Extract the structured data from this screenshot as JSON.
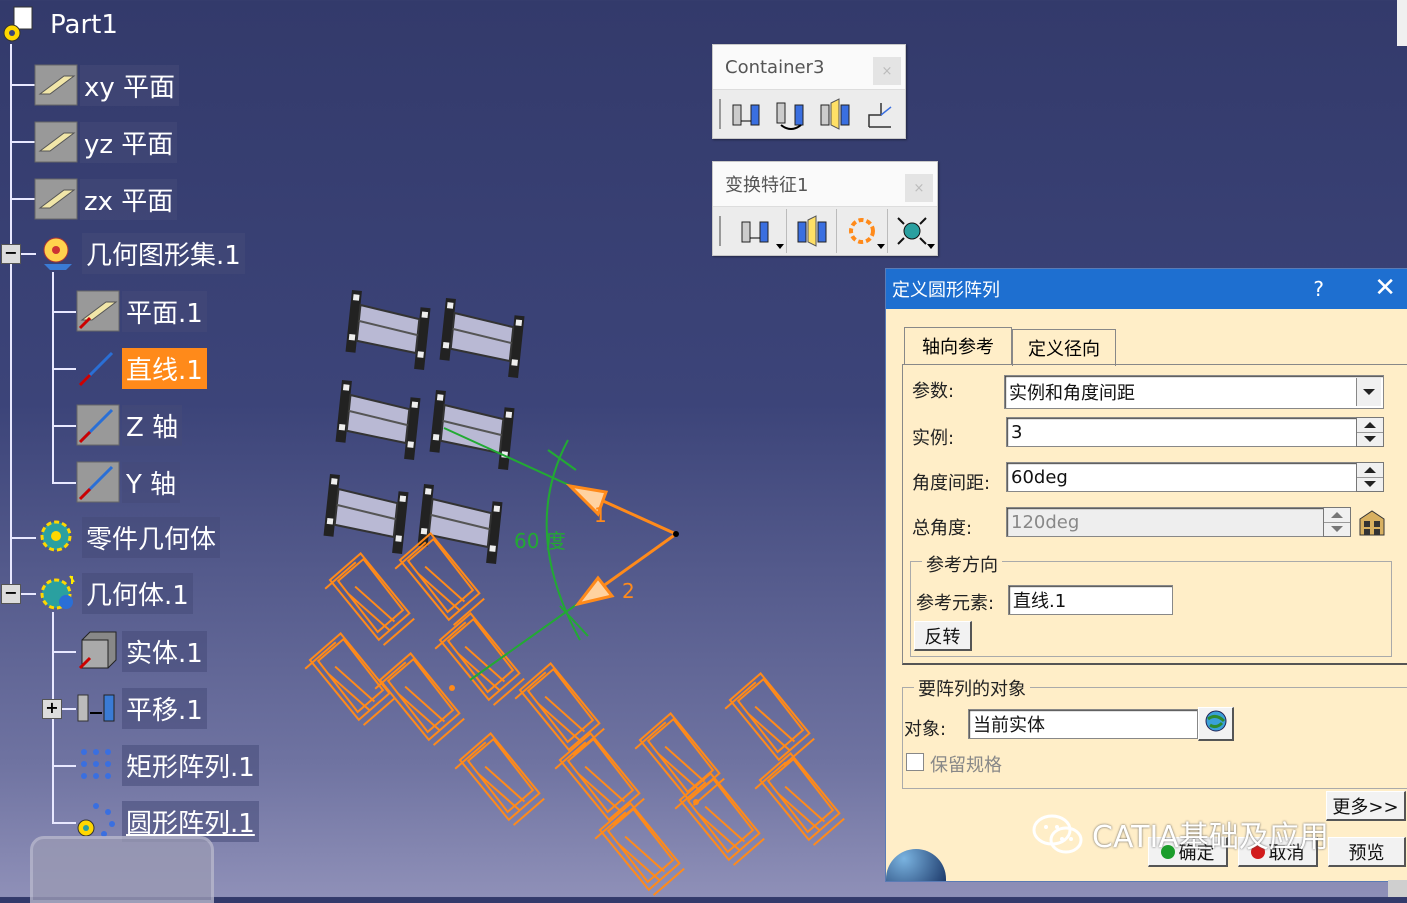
{
  "tree": {
    "root": "Part1",
    "items": [
      {
        "id": "xy",
        "label": "xy 平面"
      },
      {
        "id": "yz",
        "label": "yz 平面"
      },
      {
        "id": "zx",
        "label": "zx 平面"
      },
      {
        "id": "geoset",
        "label": "几何图形集.1"
      },
      {
        "id": "plane1",
        "label": "平面.1"
      },
      {
        "id": "line1",
        "label": "直线.1"
      },
      {
        "id": "zaxis",
        "label": "Z 轴"
      },
      {
        "id": "yaxis",
        "label": "Y 轴"
      },
      {
        "id": "partbody",
        "label": "零件几何体"
      },
      {
        "id": "body1",
        "label": "几何体.1"
      },
      {
        "id": "solid1",
        "label": "实体.1"
      },
      {
        "id": "translate1",
        "label": "平移.1"
      },
      {
        "id": "rectpattern1",
        "label": "矩形阵列.1"
      },
      {
        "id": "circpattern1",
        "label": "圆形阵列.1"
      }
    ],
    "expanders": {
      "plus": "+",
      "minus": "−"
    }
  },
  "toolbars": {
    "container3": {
      "title": "Container3",
      "close": "×"
    },
    "transform": {
      "title": "变换特征1",
      "close": "×"
    }
  },
  "viewport": {
    "angle_label": "60 度",
    "marker1": "1",
    "marker2": "2"
  },
  "dialog": {
    "title": "定义圆形阵列",
    "help": "?",
    "close": "✕",
    "tabs": [
      "轴向参考",
      "定义径向"
    ],
    "params_label": "参数:",
    "params_value": "实例和角度间距",
    "instances_label": "实例:",
    "instances_value": "3",
    "angle_spacing_label": "角度间距:",
    "angle_spacing_value": "60deg",
    "total_angle_label": "总角度:",
    "total_angle_value": "120deg",
    "ref_direction_title": "参考方向",
    "ref_element_label": "参考元素:",
    "ref_element_value": "直线.1",
    "reverse_button": "反转",
    "object_group_title": "要阵列的对象",
    "object_label": "对象:",
    "object_value": "当前实体",
    "keep_spec_label": "保留规格",
    "more_button": "更多>>",
    "ok_button": "确定",
    "cancel_button": "取消",
    "preview_button": "预览"
  },
  "watermark": "CATIA基础及应用",
  "colors": {
    "background": "#3c4479",
    "selection": "#ff8a1a",
    "dialog_bg": "#ffeec8",
    "titlebar": "#1e6fd0",
    "construction": "#22aa33",
    "orange": "#ff8a1a"
  }
}
